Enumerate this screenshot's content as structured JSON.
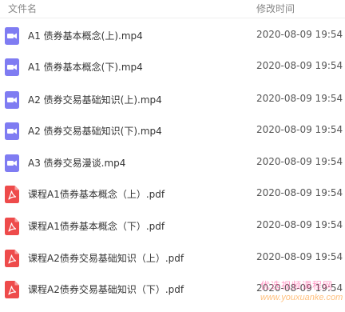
{
  "header": {
    "name_col": "文件名",
    "time_col": "修改时间"
  },
  "files": [
    {
      "name": "A1 债券基本概念(上).mp4",
      "time": "2020-08-09 19:54",
      "type": "video"
    },
    {
      "name": "A1 债券基本概念(下).mp4",
      "time": "2020-08-09 19:54",
      "type": "video"
    },
    {
      "name": "A2 债券交易基础知识(上).mp4",
      "time": "2020-08-09 19:54",
      "type": "video"
    },
    {
      "name": "A2 债券交易基础知识(下).mp4",
      "time": "2020-08-09 19:54",
      "type": "video"
    },
    {
      "name": "A3 债券交易漫谈.mp4",
      "time": "2020-08-09 19:54",
      "type": "video"
    },
    {
      "name": "课程A1债券基本概念（上）.pdf",
      "time": "2020-08-09 19:54",
      "type": "pdf"
    },
    {
      "name": "课程A1债券基本概念（下）.pdf",
      "time": "2020-08-09 19:54",
      "type": "pdf"
    },
    {
      "name": "课程A2债券交易基础知识（上）.pdf",
      "time": "2020-08-09 19:54",
      "type": "pdf"
    },
    {
      "name": "课程A2债券交易基础知识（下）.pdf",
      "time": "2020-08-09 19:54",
      "type": "pdf"
    }
  ],
  "watermark": {
    "text_cn": "优选视频课程网",
    "text_url": "www.youxuanke.com"
  },
  "colors": {
    "video_icon": "#7f7cf2",
    "pdf_icon": "#ee4b4b"
  }
}
